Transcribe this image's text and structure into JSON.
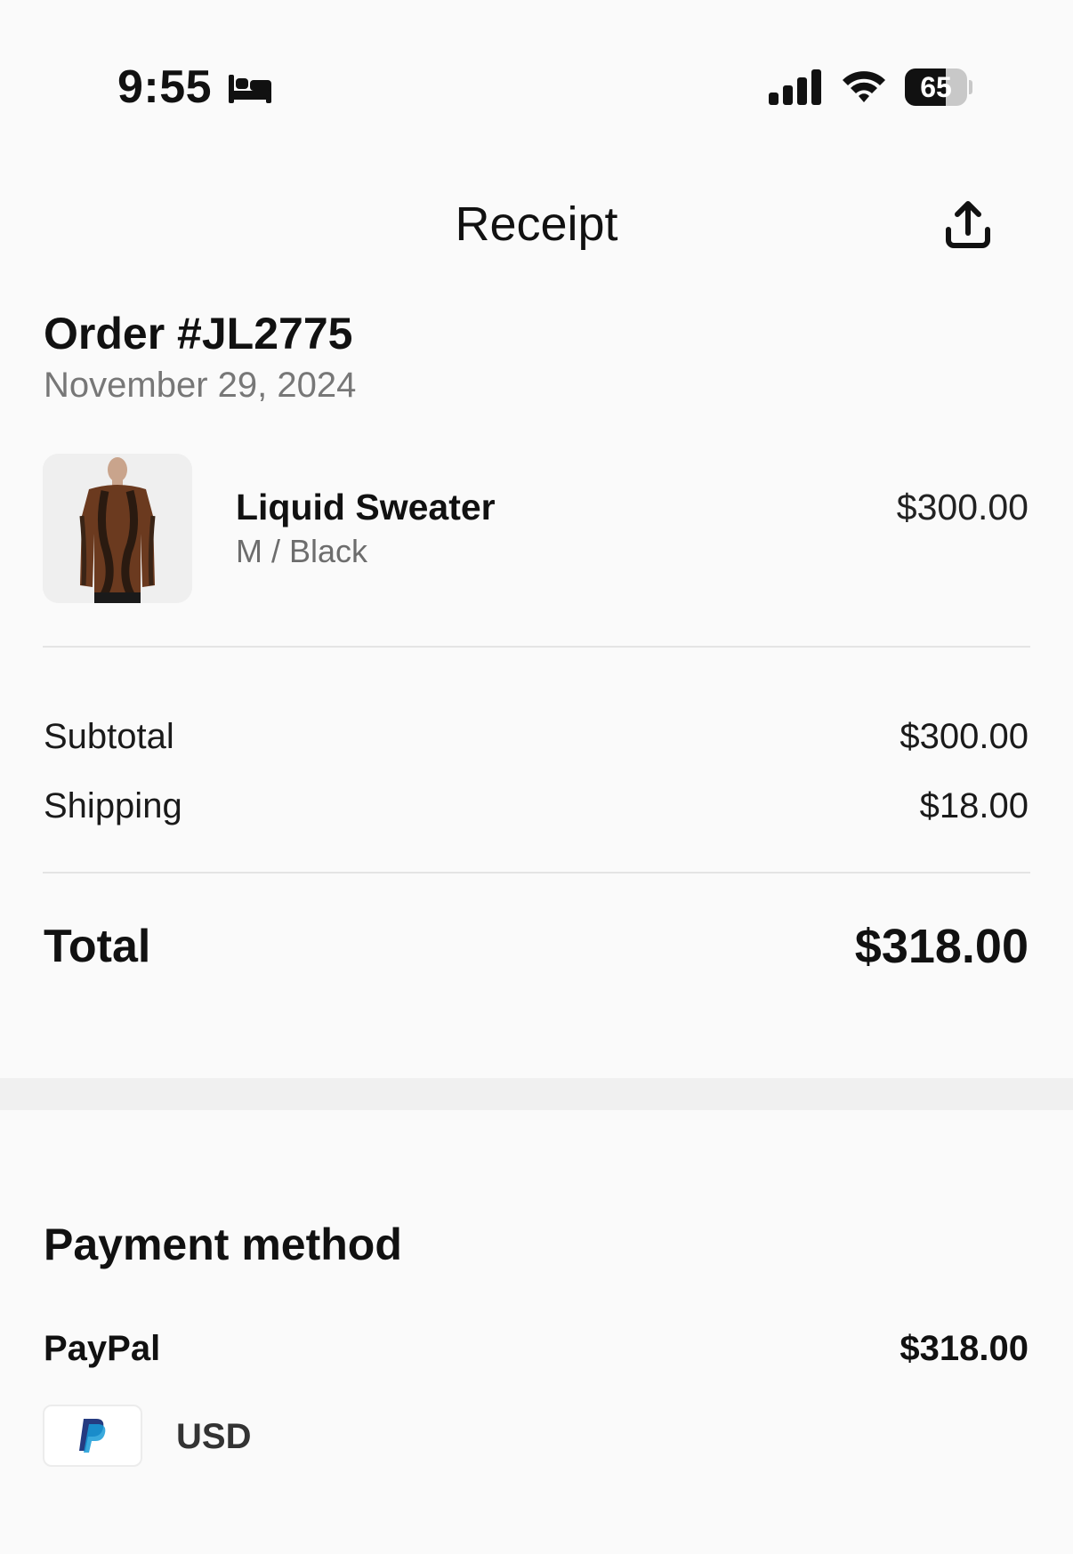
{
  "status_bar": {
    "time": "9:55",
    "battery_level": "65",
    "battery_fraction": 0.65,
    "icons": [
      "sleep-focus-icon",
      "cellular-signal-icon",
      "wifi-icon",
      "battery-icon"
    ]
  },
  "header": {
    "title": "Receipt",
    "share_icon": "share-icon"
  },
  "order": {
    "number": "Order #JL2775",
    "date": "November 29, 2024"
  },
  "items": [
    {
      "name": "Liquid Sweater",
      "variant": "M / Black",
      "price": "$300.00"
    }
  ],
  "summary": {
    "subtotal_label": "Subtotal",
    "subtotal_value": "$300.00",
    "shipping_label": "Shipping",
    "shipping_value": "$18.00",
    "total_label": "Total",
    "total_value": "$318.00"
  },
  "payment": {
    "title": "Payment method",
    "method": "PayPal",
    "amount": "$318.00",
    "currency": "USD",
    "icon": "paypal-icon"
  },
  "colors": {
    "background": "#fafafa",
    "text": "#111111",
    "muted_text": "#777777",
    "paypal_dark_blue": "#253b80",
    "paypal_light_blue": "#179bd7"
  }
}
